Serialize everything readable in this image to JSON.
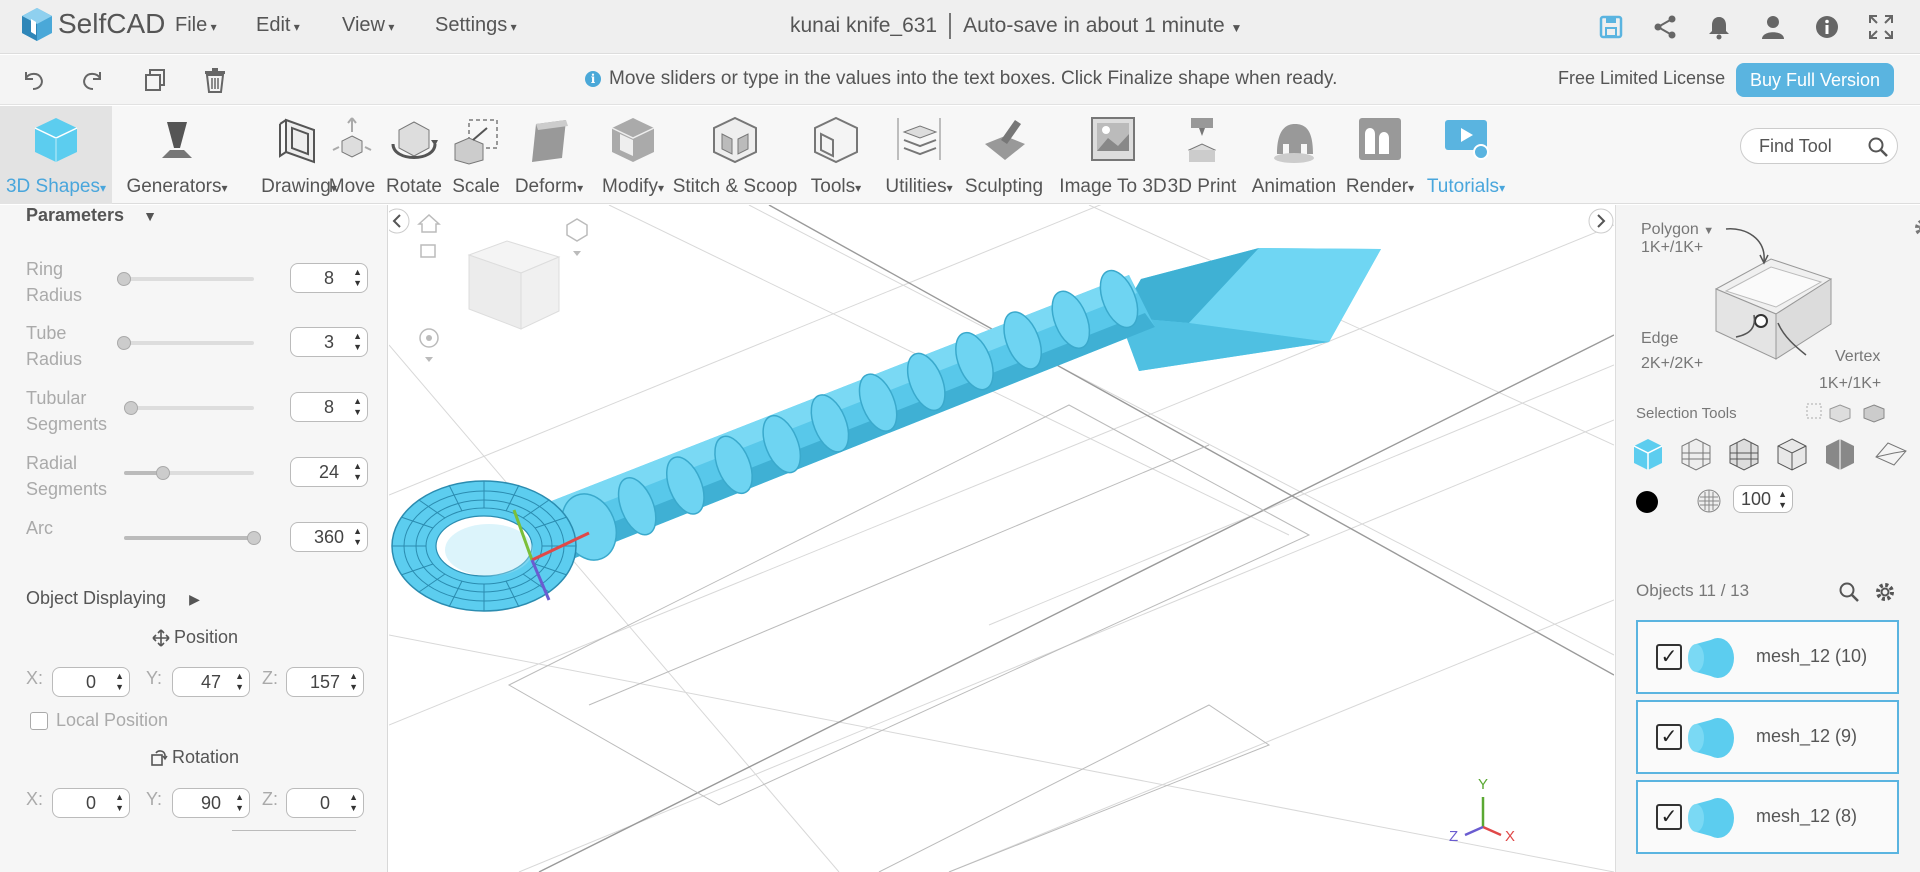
{
  "app": {
    "name": "SelfCAD",
    "document_title": "kunai knife_631",
    "autosave": "Auto-save in about 1 minute"
  },
  "menu": [
    "File",
    "Edit",
    "View",
    "Settings"
  ],
  "header_icons": [
    "save-icon",
    "share-icon",
    "bell-icon",
    "user-icon",
    "info-icon",
    "fullscreen-icon"
  ],
  "hint": "Move sliders or type in the values into the text boxes. Click Finalize shape when ready.",
  "license": {
    "text": "Free Limited License",
    "buy": "Buy Full Version"
  },
  "toolbar": [
    {
      "label": "3D Shapes",
      "dropdown": true,
      "active": true
    },
    {
      "label": "Generators",
      "dropdown": true
    },
    {
      "label": "Drawing",
      "dropdown": true
    },
    {
      "label": "Move"
    },
    {
      "label": "Rotate"
    },
    {
      "label": "Scale"
    },
    {
      "label": "Deform",
      "dropdown": true
    },
    {
      "label": "Modify",
      "dropdown": true
    },
    {
      "label": "Stitch & Scoop"
    },
    {
      "label": "Tools",
      "dropdown": true
    },
    {
      "label": "Utilities",
      "dropdown": true
    },
    {
      "label": "Sculpting"
    },
    {
      "label": "Image To 3D"
    },
    {
      "label": "3D Print"
    },
    {
      "label": "Animation"
    },
    {
      "label": "Render",
      "dropdown": true
    },
    {
      "label": "Tutorials",
      "dropdown": true,
      "highlight": true
    }
  ],
  "find_tool": "Find Tool",
  "parameters": {
    "title": "Parameters",
    "items": [
      {
        "label1": "Ring",
        "label2": "Radius",
        "value": "8",
        "level": 0.0
      },
      {
        "label1": "Tube",
        "label2": "Radius",
        "value": "3",
        "level": 0.0
      },
      {
        "label1": "Tubular",
        "label2": "Segments",
        "value": "8",
        "level": 0.05
      },
      {
        "label1": "Radial",
        "label2": "Segments",
        "value": "24",
        "level": 0.3
      },
      {
        "label1": "Arc",
        "label2": "",
        "value": "360",
        "level": 1.0
      }
    ]
  },
  "object_displaying": {
    "title": "Object Displaying",
    "position_label": "Position",
    "position": {
      "x": "0",
      "y": "47",
      "z": "157"
    },
    "local_position": "Local Position",
    "rotation_label": "Rotation",
    "rotation": {
      "x": "0",
      "y": "90",
      "z": "0"
    },
    "axes": {
      "x": "X:",
      "y": "Y:",
      "z": "Z:"
    }
  },
  "right": {
    "polygon": {
      "label": "Polygon",
      "count": "1K+/1K+"
    },
    "edge": {
      "label": "Edge",
      "count": "2K+/2K+"
    },
    "vertex": {
      "label": "Vertex",
      "count": "1K+/1K+"
    },
    "selection_tools": "Selection Tools",
    "opacity": "100",
    "objects_header": "Objects 11 / 13",
    "objects": [
      "mesh_12 (10)",
      "mesh_12 (9)",
      "mesh_12 (8)"
    ]
  },
  "axis_gizmo": {
    "x": "X",
    "y": "Y",
    "z": "Z"
  },
  "colors": {
    "accent": "#5ab4e0",
    "mesh": "#5dcdf0",
    "mesh_dark": "#3aa9cc"
  }
}
